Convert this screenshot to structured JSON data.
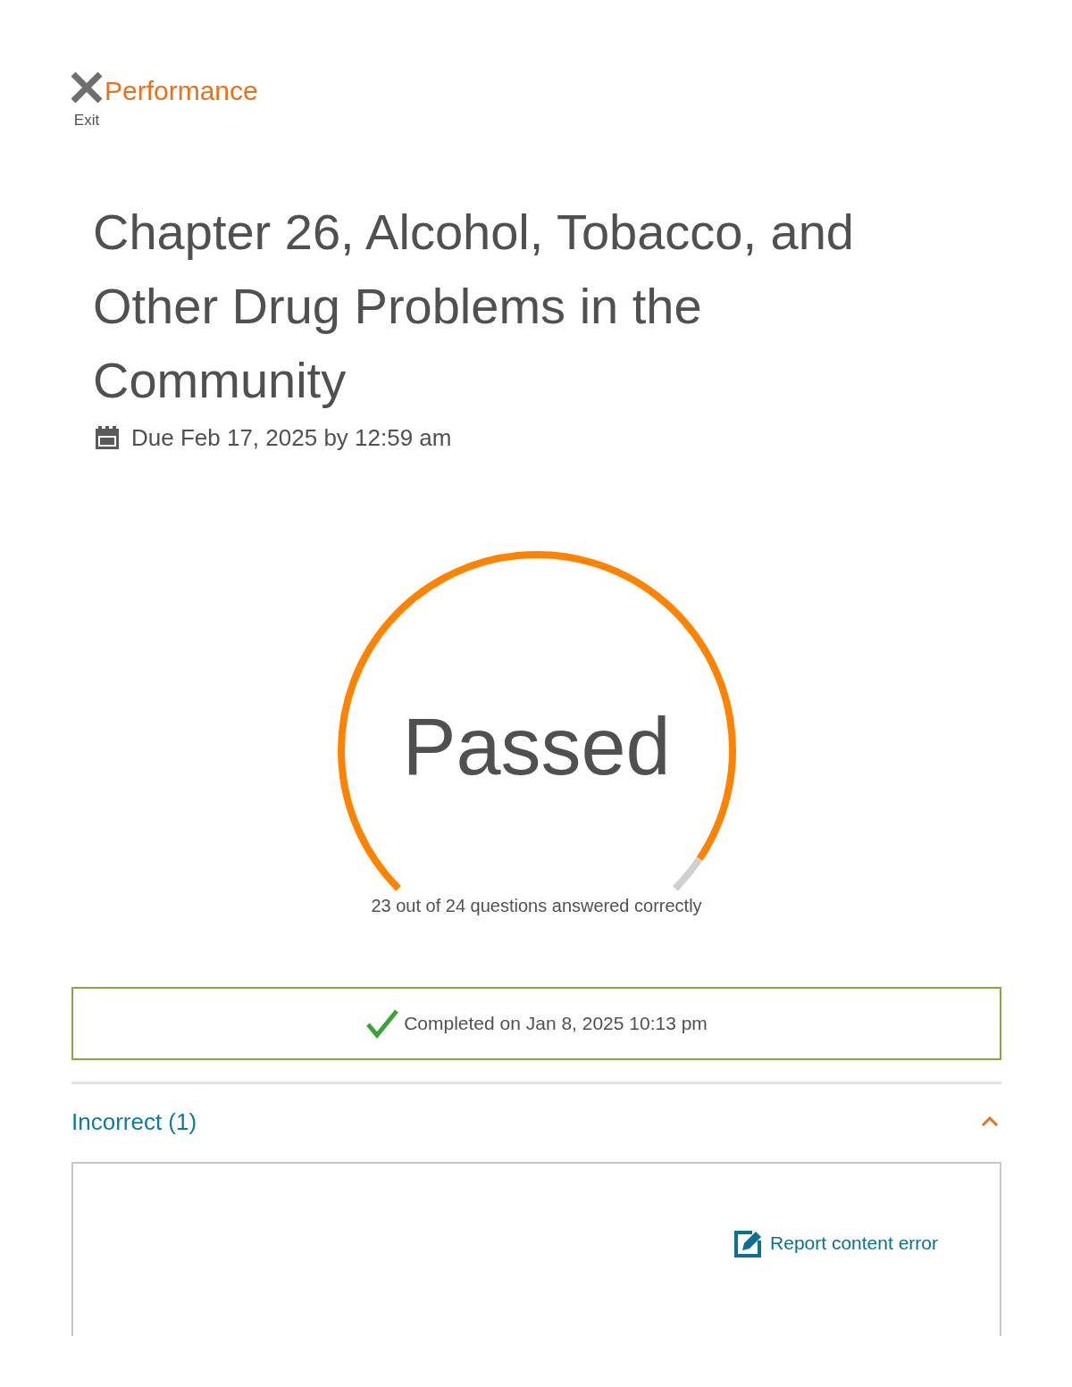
{
  "header": {
    "exit_label": "Exit",
    "title": "Performance"
  },
  "assignment": {
    "title": "Chapter 26, Alcohol, Tobacco, and Other Drug Problems in the Community",
    "due": "Due Feb 17, 2025 by 12:59 am"
  },
  "result": {
    "status": "Passed",
    "level": 0.9583,
    "summary": "23 out of 24 questions answered correctly"
  },
  "completion": {
    "text": "Completed on Jan 8, 2025 10:13 pm"
  },
  "sections": [
    {
      "label": "Incorrect (1)",
      "expanded": true,
      "links": [
        "Report content error"
      ]
    }
  ]
}
